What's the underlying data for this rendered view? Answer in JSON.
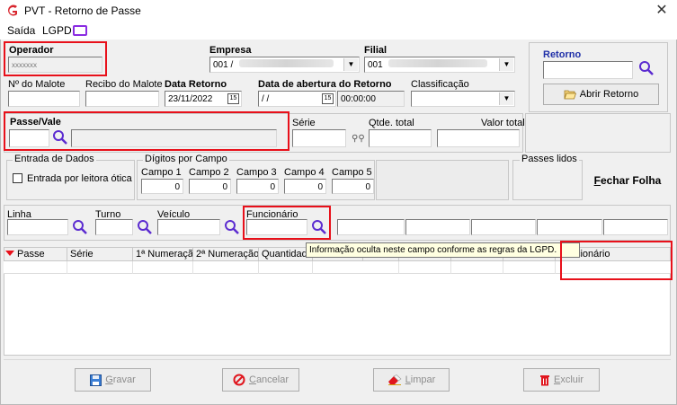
{
  "window": {
    "title": "PVT - Retorno de Passe",
    "close": "✕"
  },
  "menu": {
    "saida": "Saída",
    "lgpd": "LGPD"
  },
  "operador": {
    "label": "Operador",
    "value": "xxxxxxx"
  },
  "empresa": {
    "label": "Empresa",
    "value": "001 /"
  },
  "filial": {
    "label": "Filial",
    "value": "001"
  },
  "retorno": {
    "label": "Retorno",
    "value": "",
    "abrir_button": "Abrir Retorno"
  },
  "malote": {
    "label": "Nº do Malote",
    "value": ""
  },
  "recibo": {
    "label": "Recibo do Malote",
    "value": ""
  },
  "data_retorno": {
    "label": "Data Retorno",
    "value": "23/11/2022",
    "cal": "15"
  },
  "data_abertura": {
    "label": "Data de abertura do Retorno",
    "date": " / /",
    "time": "00:00:00",
    "cal": "15"
  },
  "classificacao": {
    "label": "Classificação",
    "value": ""
  },
  "passe_vale": {
    "label": "Passe/Vale",
    "value": "",
    "description": ""
  },
  "serie": {
    "label": "Série",
    "value": ""
  },
  "qtde_total": {
    "label": "Qtde. total",
    "value": ""
  },
  "valor_total": {
    "label": "Valor total",
    "value": ""
  },
  "entrada_dados": {
    "title": "Entrada de Dados",
    "checkbox_label": "Entrada por leitora ótica",
    "checked": false
  },
  "digitos": {
    "title": "Dígitos por Campo",
    "campos": [
      {
        "label": "Campo 1",
        "value": "0"
      },
      {
        "label": "Campo 2",
        "value": "0"
      },
      {
        "label": "Campo 3",
        "value": "0"
      },
      {
        "label": "Campo 4",
        "value": "0"
      },
      {
        "label": "Campo 5",
        "value": "0"
      }
    ]
  },
  "passes_lidos": {
    "title": "Passes lidos"
  },
  "fechar_folha": {
    "label": "Fechar Folha",
    "mnemonic": "F",
    "rest": "echar Folha"
  },
  "filters": {
    "linha": "Linha",
    "turno": "Turno",
    "veiculo": "Veículo",
    "funcionario": "Funcionário"
  },
  "grid": {
    "columns": [
      "Passe",
      "Série",
      "1ª Numeração",
      "2ª Numeração",
      "Quantidade",
      "",
      "",
      "",
      "",
      "",
      "Funcionário"
    ]
  },
  "tooltip": "Informação oculta neste campo conforme as regras da LGPD.",
  "buttons": {
    "gravar": {
      "m": "G",
      "rest": "ravar"
    },
    "cancelar": {
      "m": "C",
      "rest": "ancelar"
    },
    "limpar": {
      "m": "L",
      "rest": "impar"
    },
    "excluir": {
      "m": "E",
      "rest": "xcluir"
    }
  },
  "colors": {
    "accent_red": "#e8101a",
    "brand_red": "#d8262e",
    "link_blue": "#1f2fa8",
    "search_purple": "#5b2bd0"
  }
}
